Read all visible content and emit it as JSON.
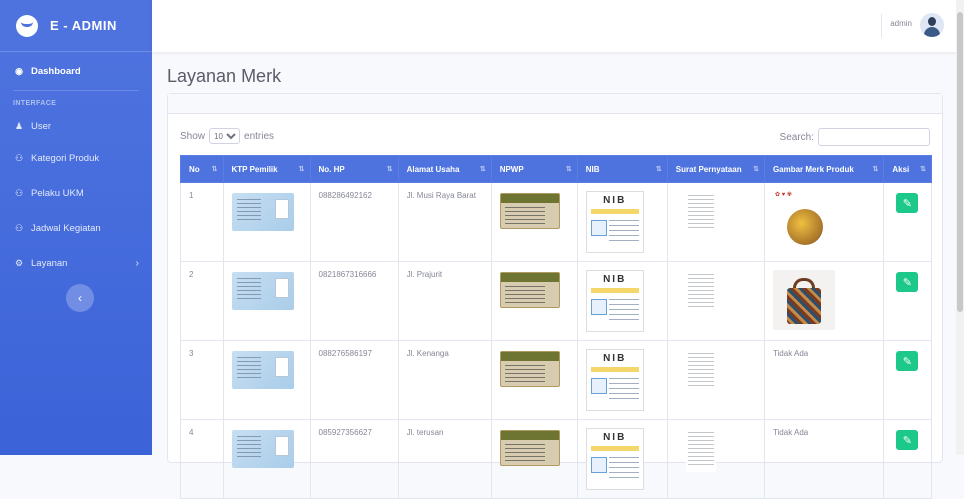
{
  "brand": {
    "name": "E - ADMIN"
  },
  "sidebar": {
    "dashboard": "Dashboard",
    "heading": "INTERFACE",
    "items": [
      {
        "label": "User",
        "icon": "user-icon"
      },
      {
        "label": "Kategori Produk",
        "icon": "users-icon"
      },
      {
        "label": "Pelaku UKM",
        "icon": "users-icon"
      },
      {
        "label": "Jadwal Kegiatan",
        "icon": "users-icon"
      },
      {
        "label": "Layanan",
        "icon": "gear-icon"
      }
    ]
  },
  "topbar": {
    "user": "admin"
  },
  "page": {
    "title": "Layanan Merk"
  },
  "table_controls": {
    "show": "Show",
    "entries_value": "10",
    "entries": "entries",
    "search": "Search:"
  },
  "table": {
    "headers": [
      "No",
      "KTP Pemilik",
      "No. HP",
      "Alamat Usaha",
      "NPWP",
      "NIB",
      "Surat Pernyataan",
      "Gambar Merk Produk",
      "Aksi"
    ],
    "nib_label": "NIB",
    "rows": [
      {
        "no": "1",
        "hp": "088286492162",
        "alamat": "Jl. Musi Raya Barat",
        "gambar": "image-1"
      },
      {
        "no": "2",
        "hp": "0821867316666",
        "alamat": "Jl. Prajurit",
        "gambar": "image-2"
      },
      {
        "no": "3",
        "hp": "088276586197",
        "alamat": "Jl. Kenanga",
        "gambar": "Tidak Ada"
      },
      {
        "no": "4",
        "hp": "085927356627",
        "alamat": "Jl. terusan",
        "gambar": "Tidak Ada"
      }
    ]
  },
  "colors": {
    "primary": "#4e73df",
    "success": "#1cc88a"
  }
}
